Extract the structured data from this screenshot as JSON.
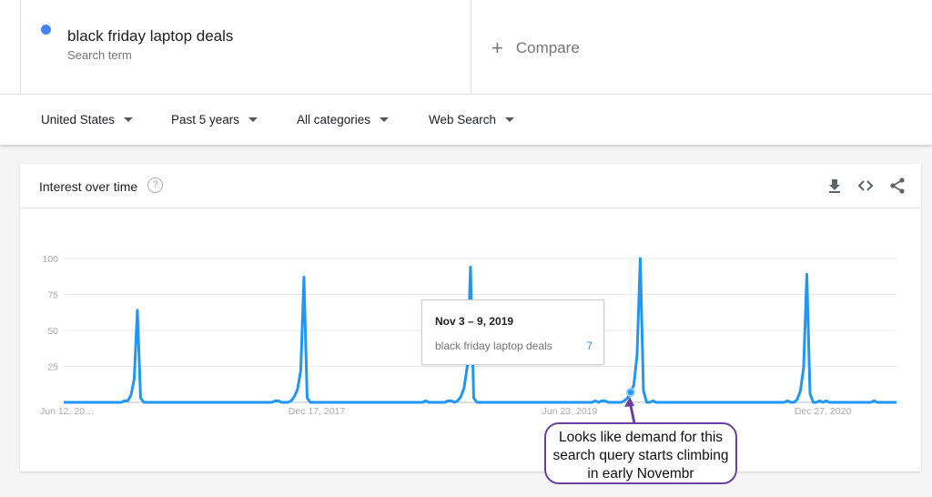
{
  "search_term": {
    "name": "black friday laptop deals",
    "subtitle": "Search term",
    "color": "#4285f4"
  },
  "compare": {
    "label": "Compare",
    "icon": "plus-icon"
  },
  "filters": [
    {
      "label": "United States"
    },
    {
      "label": "Past 5 years"
    },
    {
      "label": "All categories"
    },
    {
      "label": "Web Search"
    }
  ],
  "card": {
    "title": "Interest over time",
    "icons": [
      "help-icon",
      "download-icon",
      "embed-code-icon",
      "share-icon"
    ]
  },
  "tooltip": {
    "date": "Nov 3 – 9, 2019",
    "term": "black friday laptop deals",
    "value": "7"
  },
  "annotation": {
    "text": "Looks like demand for this search query starts climbing in early Novembr",
    "color": "#6b3fa0"
  },
  "chart_data": {
    "type": "line",
    "xlim": [
      "2016-06-12",
      "2021-06-06"
    ],
    "ylim": [
      0,
      100
    ],
    "yticks": [
      "25",
      "50",
      "75",
      "100"
    ],
    "xticks": [
      {
        "date": "2016-06-12",
        "label": "Jun 12, 20…"
      },
      {
        "date": "2017-12-17",
        "label": "Dec 17, 2017"
      },
      {
        "date": "2019-06-23",
        "label": "Jun 23, 2019"
      },
      {
        "date": "2020-12-27",
        "label": "Dec 27, 2020"
      }
    ],
    "grid": true,
    "series": [
      {
        "color": "#2196f3",
        "points": [
          [
            "2016-06-12",
            0
          ],
          [
            "2016-10-16",
            0
          ],
          [
            "2016-10-23",
            1
          ],
          [
            "2016-10-30",
            1
          ],
          [
            "2016-11-06",
            5
          ],
          [
            "2016-11-13",
            16
          ],
          [
            "2016-11-20",
            64
          ],
          [
            "2016-11-27",
            3
          ],
          [
            "2016-12-04",
            0
          ],
          [
            "2017-09-10",
            0
          ],
          [
            "2017-09-17",
            1
          ],
          [
            "2017-09-24",
            1
          ],
          [
            "2017-10-01",
            0
          ],
          [
            "2017-10-15",
            0
          ],
          [
            "2017-10-22",
            1
          ],
          [
            "2017-10-29",
            4
          ],
          [
            "2017-11-05",
            9
          ],
          [
            "2017-11-12",
            22
          ],
          [
            "2017-11-19",
            87
          ],
          [
            "2017-11-26",
            3
          ],
          [
            "2017-12-03",
            0
          ],
          [
            "2018-08-05",
            0
          ],
          [
            "2018-08-12",
            1
          ],
          [
            "2018-08-19",
            0
          ],
          [
            "2018-09-23",
            0
          ],
          [
            "2018-09-30",
            1
          ],
          [
            "2018-10-07",
            1
          ],
          [
            "2018-10-14",
            0
          ],
          [
            "2018-10-21",
            1
          ],
          [
            "2018-10-28",
            4
          ],
          [
            "2018-11-04",
            10
          ],
          [
            "2018-11-11",
            25
          ],
          [
            "2018-11-18",
            94
          ],
          [
            "2018-11-25",
            3
          ],
          [
            "2018-12-02",
            0
          ],
          [
            "2019-08-11",
            0
          ],
          [
            "2019-08-18",
            1
          ],
          [
            "2019-08-25",
            0
          ],
          [
            "2019-09-01",
            1
          ],
          [
            "2019-09-08",
            1
          ],
          [
            "2019-09-15",
            0
          ],
          [
            "2019-10-13",
            0
          ],
          [
            "2019-10-20",
            1
          ],
          [
            "2019-10-27",
            3
          ],
          [
            "2019-11-03",
            7
          ],
          [
            "2019-11-10",
            12
          ],
          [
            "2019-11-17",
            33
          ],
          [
            "2019-11-24",
            100
          ],
          [
            "2019-12-01",
            8
          ],
          [
            "2019-12-08",
            0
          ],
          [
            "2019-12-15",
            0
          ],
          [
            "2019-12-22",
            1
          ],
          [
            "2019-12-29",
            0
          ],
          [
            "2020-10-04",
            0
          ],
          [
            "2020-10-11",
            1
          ],
          [
            "2020-10-18",
            0
          ],
          [
            "2020-10-25",
            0
          ],
          [
            "2020-11-01",
            2
          ],
          [
            "2020-11-08",
            8
          ],
          [
            "2020-11-15",
            24
          ],
          [
            "2020-11-22",
            89
          ],
          [
            "2020-11-29",
            6
          ],
          [
            "2020-12-06",
            0
          ],
          [
            "2020-12-13",
            0
          ],
          [
            "2020-12-20",
            1
          ],
          [
            "2020-12-27",
            0
          ],
          [
            "2021-01-03",
            1
          ],
          [
            "2021-01-10",
            0
          ],
          [
            "2021-04-11",
            0
          ],
          [
            "2021-04-18",
            1
          ],
          [
            "2021-04-25",
            0
          ],
          [
            "2021-06-06",
            0
          ]
        ]
      }
    ],
    "highlight": {
      "date": "2019-11-03",
      "value": 7
    }
  }
}
